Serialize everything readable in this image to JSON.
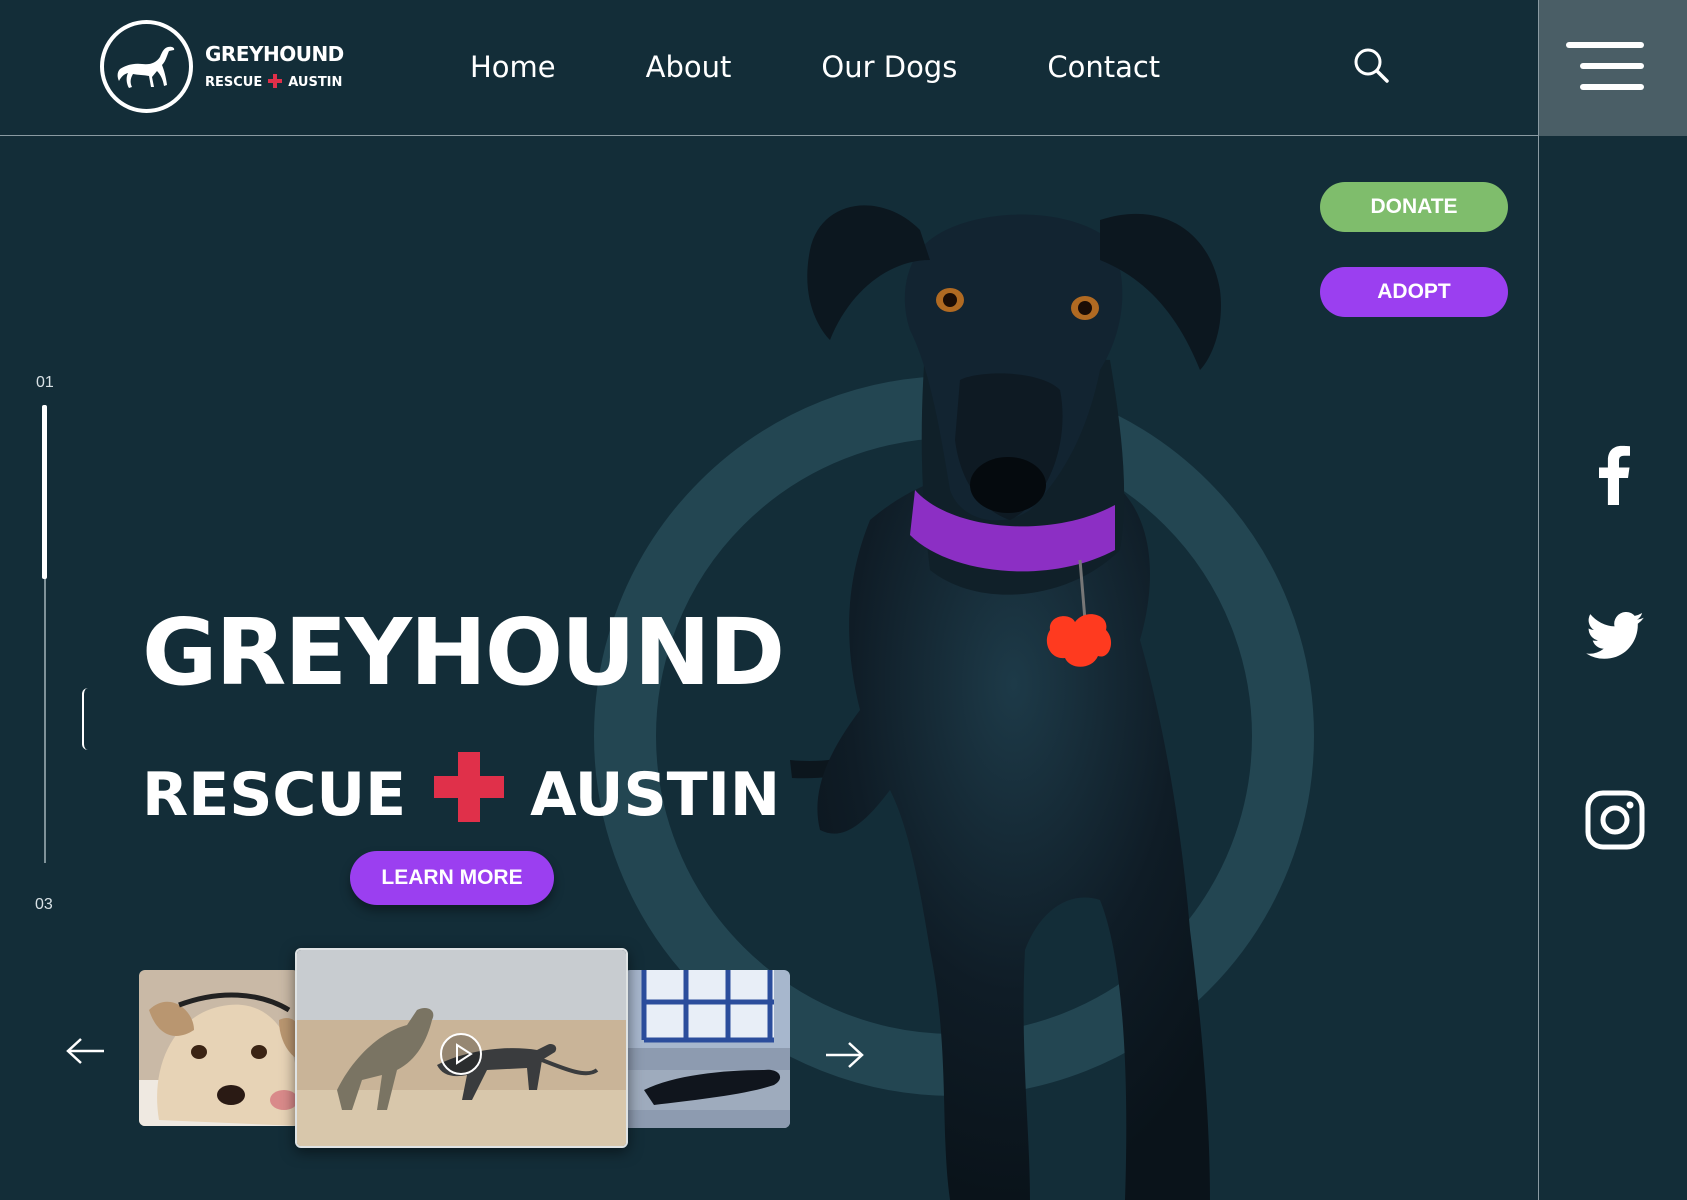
{
  "brand": {
    "title": "GREYHOUND",
    "sub_left": "RESCUE",
    "sub_right": "AUSTIN"
  },
  "nav": {
    "items": [
      "Home",
      "About",
      "Our Dogs",
      "Contact"
    ]
  },
  "hero": {
    "title": "GREYHOUND",
    "sub_left": "RESCUE",
    "sub_right": "AUSTIN",
    "learn_more": "LEARN MORE",
    "donate": "DONATE",
    "adopt": "ADOPT"
  },
  "pager": {
    "start": "01",
    "end": "03",
    "progress": 0.38
  },
  "icons": {
    "search": "search-icon",
    "menu": "hamburger-menu-icon",
    "facebook": "facebook-icon",
    "twitter": "twitter-icon",
    "instagram": "instagram-icon",
    "prev": "arrow-left-icon",
    "next": "arrow-right-icon",
    "play": "play-icon"
  },
  "colors": {
    "background": "#132d38",
    "accent_purple": "#9b3ff0",
    "donate_green": "#7fbd6c",
    "cross_red": "#e0304a",
    "menu_panel": "#4a5e66"
  }
}
